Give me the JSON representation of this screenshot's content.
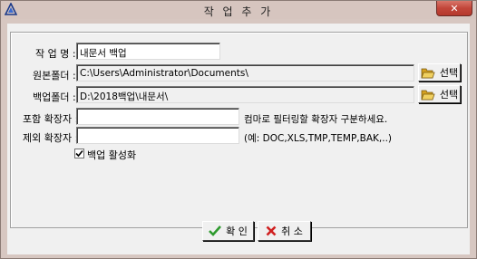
{
  "window": {
    "title": "작 업 추 가",
    "close_glyph": "✕"
  },
  "form": {
    "job_name_label": "작 업 명 :",
    "job_name_value": "내문서 백업",
    "source_label": "원본폴더 :",
    "source_value": "C:\\Users\\Administrator\\Documents\\",
    "source_browse_label": "선택",
    "backup_label": "백업폴더 :",
    "backup_value": "D:\\2018백업\\내문서\\",
    "backup_browse_label": "선택",
    "include_label": "포함 확장자 :",
    "include_value": "",
    "include_hint": "컴마로 필터링할 확장자 구분하세요.",
    "exclude_label": "제외 확장자 :",
    "exclude_value": "",
    "exclude_hint": "(예: DOC,XLS,TMP,TEMP,BAK,..)",
    "enable_backup_label": "백업 활성화",
    "enable_backup_checked": true
  },
  "buttons": {
    "ok_label": "확 인",
    "cancel_label": "취 소"
  },
  "colors": {
    "frame": "#d7c7c1",
    "close": "#c2463a",
    "ok_icon": "#2e9a2e",
    "cancel_icon": "#d02020",
    "folder_icon": "#e8c040"
  },
  "icons": {
    "app": "app-logo-icon",
    "close": "close-icon",
    "folder": "open-folder-icon",
    "ok": "checkmark-icon",
    "cancel": "x-icon"
  }
}
